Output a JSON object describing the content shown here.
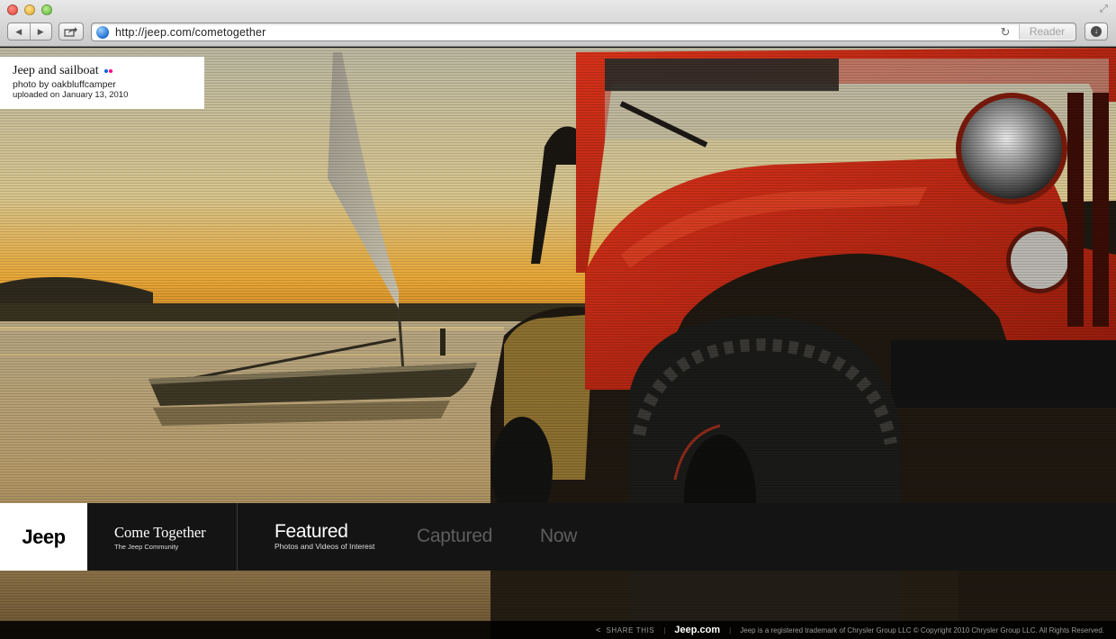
{
  "browser": {
    "url": "http://jeep.com/cometogether",
    "reader_label": "Reader"
  },
  "caption": {
    "title": "Jeep and sailboat",
    "credit": "photo by oakbluffcamper",
    "uploaded": "uploaded on January 13, 2010"
  },
  "brand": {
    "logo_text": "Jeep"
  },
  "community": {
    "title": "Come Together",
    "subtitle": "The Jeep Community"
  },
  "nav": {
    "featured": {
      "label": "Featured",
      "subtitle": "Photos and Videos of Interest"
    },
    "captured": {
      "label": "Captured"
    },
    "now": {
      "label": "Now"
    }
  },
  "footer": {
    "share_label": "SHARE THIS",
    "site_link": "Jeep.com",
    "copyright": "Jeep is a registered trademark of Chrysler Group LLC © Copyright 2010 Chrysler Group LLC. All Rights Reserved."
  },
  "colors": {
    "jeep_red": "#b8200e",
    "nav_background": "#141414",
    "inactive_nav": "#5e5e5e",
    "flickr_blue": "#0063dc",
    "flickr_pink": "#ff0084"
  },
  "icons": [
    "back-icon",
    "forward-icon",
    "share-icon",
    "globe-icon",
    "reload-icon",
    "download-icon",
    "flickr-icon"
  ]
}
